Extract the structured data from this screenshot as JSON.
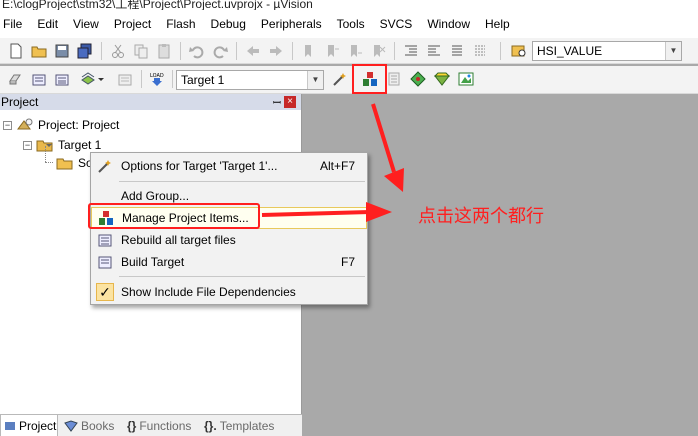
{
  "window": {
    "title": "E:\\clogProject\\stm32\\工程\\Project\\Project.uvprojx - µVision"
  },
  "menubar": {
    "items": [
      "File",
      "Edit",
      "View",
      "Project",
      "Flash",
      "Debug",
      "Peripherals",
      "Tools",
      "SVCS",
      "Window",
      "Help"
    ]
  },
  "toolbar1": {
    "search_combo_value": "HSI_VALUE"
  },
  "toolbar2": {
    "target_combo_value": "Target 1"
  },
  "panel": {
    "title": "Project",
    "pin_glyph": "ꟷ",
    "close_glyph": "×",
    "tree": {
      "root": "Project: Project",
      "target": "Target 1",
      "group_partial": "So"
    },
    "bottom_tabs": [
      "Project",
      "Books",
      "Functions",
      "Templates"
    ]
  },
  "context_menu": {
    "items": [
      {
        "label": "Options for Target 'Target 1'...",
        "shortcut": "Alt+F7"
      },
      {
        "label": "Add Group...",
        "shortcut": ""
      },
      {
        "label": "Manage Project Items...",
        "shortcut": ""
      },
      {
        "label": "Rebuild all target files",
        "shortcut": ""
      },
      {
        "label": "Build Target",
        "shortcut": "F7"
      },
      {
        "label": "Show Include File Dependencies",
        "shortcut": ""
      }
    ]
  },
  "annotation": {
    "text": "点击这两个都行",
    "color": "#ff1f1f"
  },
  "colors": {
    "highlight_red": "#ff1f1f",
    "panel_header": "#d6dbe9",
    "editor_bg": "#a9a9a9",
    "menu_hover": "#fffff0"
  }
}
